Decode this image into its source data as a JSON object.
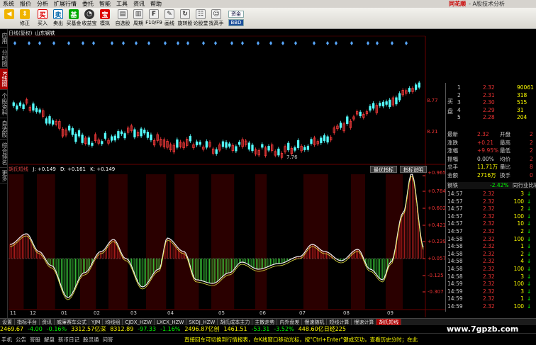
{
  "menu": {
    "items": [
      "系统",
      "报价",
      "分析",
      "扩展行情",
      "委托",
      "智能",
      "工具",
      "资讯",
      "帮助"
    ],
    "brand": "同花顺",
    "brand_sub": "- A股技术分析"
  },
  "toolbar": {
    "buttons": [
      {
        "label": "",
        "icon": "back-arrow-icon",
        "color": "#f0b400"
      },
      {
        "label": "修正",
        "icon": "up-down-icon",
        "color": "#f0b400"
      },
      {
        "label": "买入",
        "icon": "buy-icon",
        "color": "#d00"
      },
      {
        "label": "卖出",
        "icon": "sell-icon",
        "color": "#06a"
      },
      {
        "label": "买基金",
        "icon": "fund-icon",
        "color": "#0a0"
      },
      {
        "label": "收益宝",
        "icon": "gauge-icon",
        "color": "#333"
      },
      {
        "label": "模拟",
        "icon": "treasure-icon",
        "color": "#d00"
      },
      {
        "label": "自选股",
        "icon": "document-icon",
        "color": "#555"
      },
      {
        "label": "周期",
        "icon": "cycle-icon",
        "color": "#555"
      },
      {
        "label": "F10/F9",
        "icon": "f10-icon",
        "color": "#555"
      },
      {
        "label": "画线",
        "icon": "pencil-icon",
        "color": "#555"
      },
      {
        "label": "旋转股",
        "icon": "rotate-icon",
        "color": "#555"
      },
      {
        "label": "论股堂",
        "icon": "forum-icon",
        "color": "#555"
      },
      {
        "label": "找高手",
        "icon": "expert-icon",
        "color": "#555"
      }
    ],
    "right_box_top": "资金",
    "right_box_bottom": "BBD"
  },
  "left_tabs": [
    "应用",
    "分时图",
    "K线图",
    "个股资料",
    "自选股",
    "综合排名",
    "更多"
  ],
  "chart_header": {
    "period": "日线(复权)",
    "stock": "山东钢铁"
  },
  "price_axis": {
    "top": "8.77",
    "bottom": "8.21",
    "low_marker": "7.76"
  },
  "indicator": {
    "name": "胡氏短线",
    "j": "J: +0.149",
    "d": "D: +0.161",
    "k": "K: +0.149",
    "btn_best": "最优指标",
    "btn_help": "指标说明",
    "axis": [
      "+0.965",
      "+0.784",
      "+0.602",
      "+0.421",
      "+0.239",
      "+0.057",
      "-0.125",
      "-0.307"
    ]
  },
  "time_axis": [
    "11",
    "12",
    "01",
    "02",
    "03",
    "04",
    "05",
    "06",
    "07",
    "08",
    "09"
  ],
  "quote": {
    "buy_label": "买盘",
    "bids": [
      {
        "n": "1",
        "p": "2.32",
        "v": "90061"
      },
      {
        "n": "2",
        "p": "2.31",
        "v": "318"
      },
      {
        "n": "3",
        "p": "2.30",
        "v": "515"
      },
      {
        "n": "4",
        "p": "2.29",
        "v": "31"
      },
      {
        "n": "5",
        "p": "2.28",
        "v": "204"
      }
    ],
    "stats": [
      {
        "k1": "最新",
        "v1": "2.32",
        "k2": "开盘",
        "v2": "2"
      },
      {
        "k1": "涨跌",
        "v1": "+0.21",
        "k2": "最高",
        "v2": "2"
      },
      {
        "k1": "涨幅",
        "v1": "+9.95%",
        "k2": "最低",
        "v2": "2"
      },
      {
        "k1": "振幅",
        "v1": "0.00%",
        "k2": "均价",
        "v2": "2"
      },
      {
        "k1": "总手",
        "v1": "11.71万",
        "k2": "量比",
        "v2": "8"
      },
      {
        "k1": "金额",
        "v1": "2716万",
        "k2": "换手",
        "v2": "0"
      }
    ],
    "sector": {
      "name": "钢铁",
      "change": "-2.42%",
      "compare": "同行业比较"
    },
    "ticks": [
      {
        "t": "14:57",
        "p": "2.32",
        "v": "3",
        "d": "↓"
      },
      {
        "t": "14:57",
        "p": "2.32",
        "v": "100",
        "d": "↓"
      },
      {
        "t": "14:57",
        "p": "2.32",
        "v": "2",
        "d": "↓"
      },
      {
        "t": "14:57",
        "p": "2.32",
        "v": "100",
        "d": "↓"
      },
      {
        "t": "14:57",
        "p": "2.32",
        "v": "10",
        "d": "↓"
      },
      {
        "t": "14:57",
        "p": "2.32",
        "v": "2",
        "d": "↓"
      },
      {
        "t": "14:58",
        "p": "2.32",
        "v": "100",
        "d": "↓"
      },
      {
        "t": "14:58",
        "p": "2.32",
        "v": "1",
        "d": "↓"
      },
      {
        "t": "14:58",
        "p": "2.32",
        "v": "2",
        "d": "↓"
      },
      {
        "t": "14:58",
        "p": "2.32",
        "v": "4",
        "d": "↓"
      },
      {
        "t": "14:58",
        "p": "2.32",
        "v": "100",
        "d": "↓"
      },
      {
        "t": "14:58",
        "p": "2.32",
        "v": "3",
        "d": "↓"
      },
      {
        "t": "14:59",
        "p": "2.32",
        "v": "100",
        "d": "↓"
      },
      {
        "t": "14:59",
        "p": "2.32",
        "v": "3",
        "d": "↓"
      },
      {
        "t": "14:59",
        "p": "2.32",
        "v": "1",
        "d": "↓"
      },
      {
        "t": "14:59",
        "p": "2.32",
        "v": "100",
        "d": "↓"
      }
    ]
  },
  "bottom_tabs": [
    "设置",
    "指标平台",
    "资讯",
    "威廉赛车公式",
    "YJM",
    "均线组",
    "CJDX_HZW",
    "LXCX_HZW",
    "SKDJ_HZW",
    "胡氏成本主力",
    "主散走势",
    "内外盘差",
    "慢速随机",
    "短线计算",
    "慢速计算",
    "胡氏短线"
  ],
  "index_bar": [
    {
      "text": "2469.67",
      "color": "#ff0"
    },
    {
      "text": "-4.00",
      "color": "#0f0"
    },
    {
      "text": "-0.16%",
      "color": "#0f0"
    },
    {
      "text": "3312.57亿深",
      "color": "#ff0"
    },
    {
      "text": "8312.89",
      "color": "#ff0"
    },
    {
      "text": "-97.33",
      "color": "#0f0"
    },
    {
      "text": "-1.16%",
      "color": "#0f0"
    },
    {
      "text": "2496.87亿创",
      "color": "#ff0"
    },
    {
      "text": "1461.51",
      "color": "#ff0"
    },
    {
      "text": "-53.31",
      "color": "#0f0"
    },
    {
      "text": "-3.52%",
      "color": "#0f0"
    },
    {
      "text": "448.60亿日经225",
      "color": "#ff0"
    }
  ],
  "status": {
    "items": [
      "手机",
      "公告",
      "答股",
      "解盘",
      "新币日记",
      "股灵通",
      "问答"
    ],
    "marquee": "直接回车可切换到行情报表，在K线窗口移动光标，按\"Ctrl+Enter\"键成交功，查看历史分时；在此"
  },
  "watermark": "www.7gpzb.com"
}
